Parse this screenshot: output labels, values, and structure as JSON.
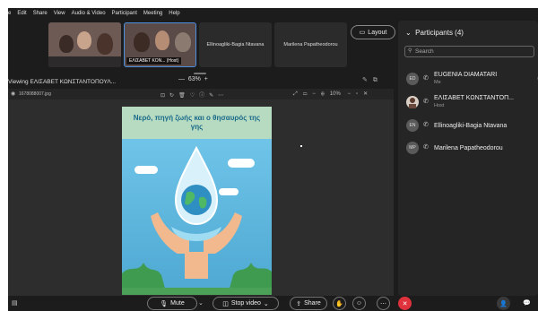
{
  "menu": [
    "e",
    "Edit",
    "Share",
    "View",
    "Audio & Video",
    "Participant",
    "Meeting",
    "Help"
  ],
  "thumbnails": {
    "host_label": "ΕΛΙΣΑΒΕΤ ΚΟΝ... (Host)",
    "names": [
      "Ellinoagliki-Bagia Ntavana",
      "Marilena Papatheodorou"
    ]
  },
  "layout_label": "Layout",
  "viewing": {
    "title": "Viewing ΕΛΙΣΑΒΕΤ ΚΩΝΣΤΑΝΤΟΠΟΥΛ...",
    "zoom_minus": "—",
    "zoom": "63%",
    "zoom_plus": "+"
  },
  "viewer": {
    "filename": "1678088007.jpg",
    "zoom": "10%"
  },
  "poster": {
    "title": "Νερό, πηγή ζωής και ο θησαυρός της γης"
  },
  "participants": {
    "title": "Participants (4)",
    "search_placeholder": "Search",
    "list": [
      {
        "initials": "ED",
        "name": "EUGENIA DIAMATARI",
        "sub": "Me"
      },
      {
        "initials": "",
        "name": "ΕΛΙΣΑΒΕΤ ΚΩΝΣΤΑΝΤΟΠ...",
        "sub": "Host"
      },
      {
        "initials": "EN",
        "name": "Ellinoagliki-Bagia Ntavana",
        "sub": ""
      },
      {
        "initials": "MP",
        "name": "Marilena Papatheodorou",
        "sub": ""
      }
    ]
  },
  "controls": {
    "mute": "Mute",
    "stop_video": "Stop video",
    "share": "Share"
  },
  "colors": {
    "leave": "#e0323d",
    "accent": "#4a8fe0",
    "poster_header": "#b7dbc1",
    "poster_sky": "#59b3d6"
  }
}
